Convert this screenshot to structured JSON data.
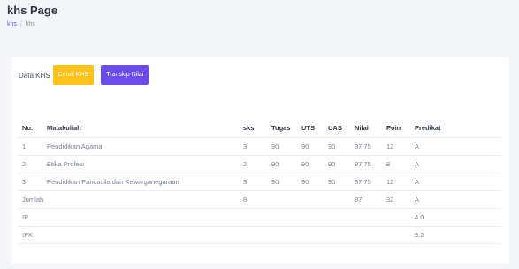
{
  "header": {
    "title": "khs Page",
    "breadcrumb": [
      "khs",
      "khs"
    ]
  },
  "tabs": {
    "data_khs": "Data KHS",
    "cetak_khs": "Cetak KHS",
    "transkip_nilai": "Transkip Nilai"
  },
  "colors": {
    "cetak_button": "#ffc21c",
    "transkip_button": "#6c4ce8",
    "breadcrumb_link": "#5a6cd8"
  },
  "table": {
    "headers": [
      "No.",
      "Matakuliah",
      "sks",
      "Tugas",
      "UTS",
      "UAS",
      "Nilai",
      "Poin",
      "Predikat"
    ],
    "rows": [
      [
        "1",
        "Pendidikan Agama",
        "3",
        "90",
        "90",
        "90",
        "87.75",
        "12",
        "A"
      ],
      [
        "2",
        "Etika Profesi",
        "2",
        "90",
        "90",
        "90",
        "87.75",
        "8",
        "A"
      ],
      [
        "3",
        "Pendidikan Pancasila dan Kewarganegaraan",
        "3",
        "90",
        "90",
        "90",
        "87.75",
        "12",
        "A"
      ]
    ],
    "jumlah": {
      "label": "Jumlah",
      "sks": "8",
      "nilai": "87",
      "poin": "32",
      "predikat": "A"
    },
    "ip": {
      "label": "IP",
      "value": "4.0"
    },
    "ipk": {
      "label": "IPK",
      "value": "3.2"
    }
  }
}
